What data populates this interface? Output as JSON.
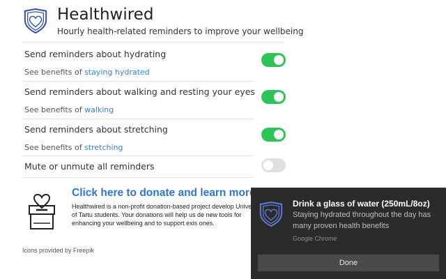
{
  "app": {
    "title": "Healthwired",
    "subtitle": "Hourly health-related reminders to improve your wellbeing"
  },
  "settings": [
    {
      "label": "Send reminders about hydrating",
      "benefit_prefix": "See benefits of ",
      "benefit_link": "staying hydrated",
      "enabled": true
    },
    {
      "label": "Send reminders about walking and resting your eyes",
      "benefit_prefix": "See benefits of ",
      "benefit_link": "walking",
      "enabled": true
    },
    {
      "label": "Send reminders about stretching",
      "benefit_prefix": "See benefits of ",
      "benefit_link": "stretching",
      "enabled": true
    }
  ],
  "mute": {
    "label": "Mute or unmute all reminders",
    "enabled": false
  },
  "donate": {
    "link": "Click here to donate and learn more",
    "text": "Healthwired is a non-profit donation-based project develop University of Tartu students. Your donations will help us de new tools for enhancing your wellbeing and to support exis ones."
  },
  "credits": "Icons provided by Freepik",
  "notification": {
    "title": "Drink a glass of water (250mL/8oz)",
    "body": "Staying hydrated throughout the day has many proven health benefits",
    "source": "Google Chrome",
    "button": "Done"
  },
  "colors": {
    "toggle_on": "#2ec45a",
    "toggle_off": "#e0e0e0",
    "link": "#3b7dd8",
    "logo": "#3a56a6",
    "toast_bg": "#2b2b2b"
  }
}
